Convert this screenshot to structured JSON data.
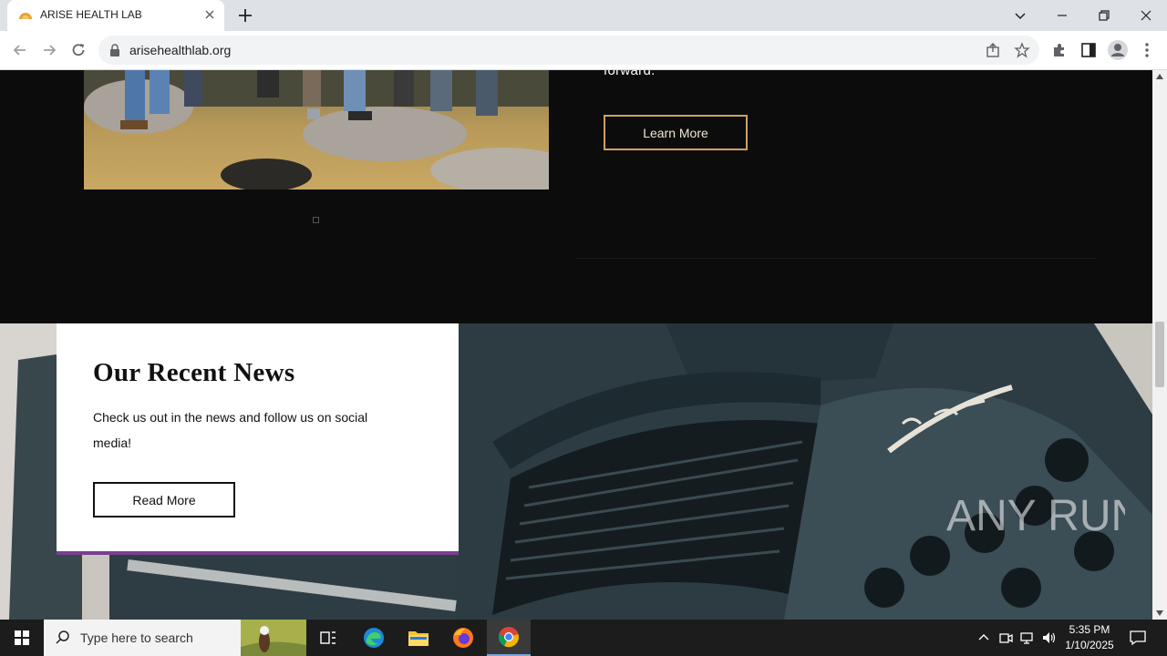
{
  "browser": {
    "tab_title": "ARISE HEALTH LAB",
    "url": "arisehealthlab.org"
  },
  "page": {
    "forward_text": "forward.",
    "learn_more_label": "Learn More",
    "news": {
      "title": "Our Recent News",
      "description": "Check us out in the news and follow us on social media!",
      "read_more_label": "Read More"
    },
    "watermark": "ANY RUN"
  },
  "taskbar": {
    "search_placeholder": "Type here to search",
    "time": "5:35 PM",
    "date": "1/10/2025"
  },
  "colors": {
    "page_background": "#0c0c0c",
    "learn_button_border": "#cfa35a",
    "card_accent": "#7a3f8f"
  }
}
